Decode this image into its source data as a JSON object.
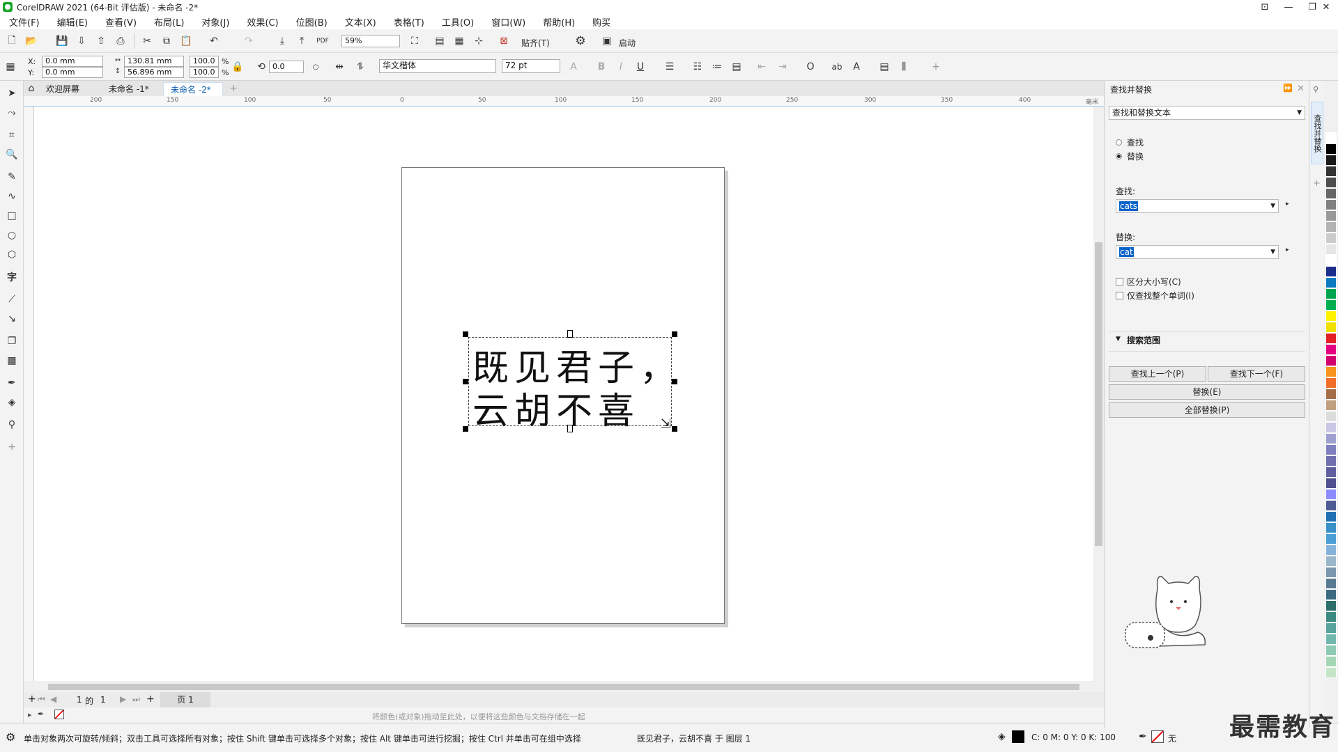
{
  "window": {
    "title": "CorelDRAW 2021 (64-Bit 评估版) - 未命名 -2*"
  },
  "menu": [
    "文件(F)",
    "编辑(E)",
    "查看(V)",
    "布局(L)",
    "对象(J)",
    "效果(C)",
    "位图(B)",
    "文本(X)",
    "表格(T)",
    "工具(O)",
    "窗口(W)",
    "帮助(H)",
    "购买"
  ],
  "toolbar": {
    "zoom": "59%",
    "snap_label": "贴齐(T)",
    "launch_label": "启动",
    "pdf": "PDF"
  },
  "props": {
    "x_label": "X:",
    "y_label": "Y:",
    "x": "0.0 mm",
    "y": "0.0 mm",
    "width": "130.81 mm",
    "height": "56.896 mm",
    "scale_w": "100.0",
    "scale_h": "100.0",
    "pct": "%",
    "rotation": "0.0",
    "font": "华文楷体",
    "size": "72 pt",
    "bold": "B",
    "italic": "I",
    "underline": "U"
  },
  "tabs": [
    "欢迎屏幕",
    "未命名 -1*",
    "未命名 -2*"
  ],
  "ruler": [
    "200",
    "150",
    "100",
    "50",
    "0",
    "50",
    "100",
    "150",
    "200",
    "250",
    "300",
    "350",
    "400",
    "毫米"
  ],
  "canvas": {
    "line1": "既见君子，",
    "line2": "云胡不喜"
  },
  "pagenav": {
    "current": "1",
    "of": "的",
    "total": "1",
    "page_tab": "页 1"
  },
  "palette_hint": "将颜色(或对象)拖动至此处，以便将这些颜色与文档存储在一起",
  "status": {
    "hint": "单击对象两次可旋转/倾斜；双击工具可选择所有对象；按住 Shift 键单击可选择多个对象；按住 Alt 键单击可进行挖掘；按住 Ctrl 并单击可在组中选择",
    "object": "既见君子，云胡不喜 于 图层 1",
    "cmyk": "C: 0 M: 0 Y: 0 K: 100",
    "none": "无"
  },
  "panel": {
    "title": "查找并替换",
    "mode": "查找和替换文本",
    "radio_find": "查找",
    "radio_replace": "替换",
    "find_label": "查找:",
    "find_value": "cats",
    "replace_label": "替换:",
    "replace_value": "cat",
    "case_label": "区分大小写(C)",
    "whole_label": "仅查找整个单词(I)",
    "scope_label": "搜索范围",
    "prev_btn": "查找上一个(P)",
    "next_btn": "查找下一个(F)",
    "replace_btn": "替换(E)",
    "replace_all_btn": "全部替换(P)",
    "tab_vertical": "查找并替换"
  },
  "watermark": "最需教育",
  "colors": {
    "accent": "#0a63c9",
    "swatches": [
      "#ffffff",
      "#000000",
      "#1a1a1a",
      "#333333",
      "#4d4d4d",
      "#666666",
      "#808080",
      "#999999",
      "#b3b3b3",
      "#cccccc",
      "#e6e6e6",
      "#ffffff",
      "#1b2e8c",
      "#0d7bc2",
      "#00a54f",
      "#00b050",
      "#fff200",
      "#f0e000",
      "#e31e24",
      "#e4007f",
      "#d3006f",
      "#f7941d",
      "#f06e28",
      "#a66d4b",
      "#c0a080",
      "#dddddd",
      "#c8c8e6",
      "#a0a0d0",
      "#8080c0",
      "#7070b0",
      "#6060a0",
      "#505090",
      "#8c8cff",
      "#4f5b93",
      "#1f6fb5",
      "#3a90c8",
      "#4aa0d6",
      "#85b2d9",
      "#9bb7cc",
      "#7a98ad",
      "#587b92",
      "#3b6b80",
      "#2c6e6a",
      "#3d8a83",
      "#58a39c",
      "#73b8af",
      "#8ec9b4",
      "#a5d7b6",
      "#c4e5c8"
    ]
  }
}
